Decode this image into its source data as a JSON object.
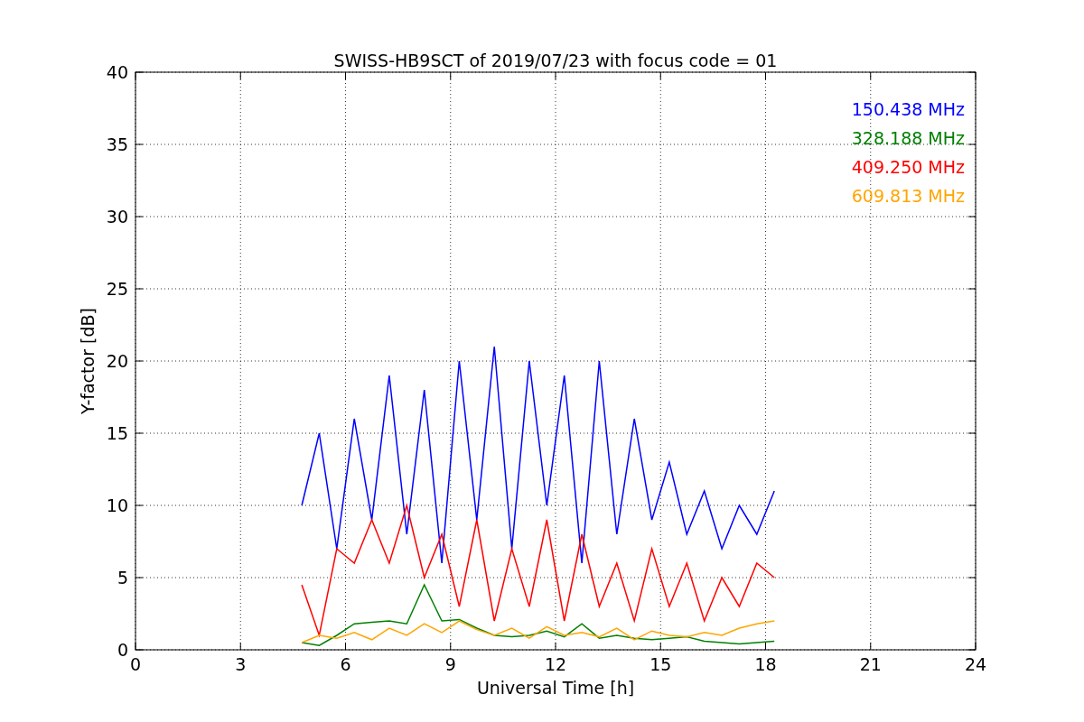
{
  "figure": {
    "chart_data": {
      "type": "line",
      "title": "SWISS-HB9SCT of 2019/07/23 with focus code = 01",
      "xlabel": "Universal Time [h]",
      "ylabel": "Y-factor [dB]",
      "x": [
        4.75,
        5.25,
        5.75,
        6.25,
        6.75,
        7.25,
        7.75,
        8.25,
        8.75,
        9.25,
        9.75,
        10.25,
        10.75,
        11.25,
        11.75,
        12.25,
        12.75,
        13.25,
        13.75,
        14.25,
        14.75,
        15.25,
        15.75,
        16.25,
        16.75,
        17.25,
        17.75,
        18.25
      ],
      "series": [
        {
          "name": "150.438 MHz",
          "color": "#0000ff",
          "values": [
            10,
            15,
            7,
            16,
            9,
            19,
            8,
            18,
            6,
            20,
            9,
            21,
            7,
            20,
            10,
            19,
            6,
            20,
            8,
            16,
            9,
            13,
            8,
            11,
            7,
            10,
            8,
            11
          ]
        },
        {
          "name": "328.188 MHz",
          "color": "#008000",
          "values": [
            0.5,
            0.3,
            1,
            1.8,
            1.9,
            2,
            1.8,
            4.5,
            2,
            2.1,
            1.5,
            1,
            0.9,
            1,
            1.3,
            0.9,
            1.8,
            0.8,
            1,
            0.8,
            0.7,
            0.8,
            0.9,
            0.6,
            0.5,
            0.4,
            0.5,
            0.6
          ]
        },
        {
          "name": "409.250 MHz",
          "color": "#ff0000",
          "values": [
            4.5,
            1,
            7,
            6,
            9,
            6,
            10,
            5,
            8,
            3,
            9,
            2,
            7,
            3,
            9,
            2,
            8,
            3,
            6,
            2,
            7,
            3,
            6,
            2,
            5,
            3,
            6,
            5
          ]
        },
        {
          "name": "609.813 MHz",
          "color": "#ffa500",
          "values": [
            0.5,
            1,
            0.8,
            1.2,
            0.7,
            1.5,
            1,
            1.8,
            1.2,
            2,
            1.4,
            1,
            1.5,
            0.8,
            1.6,
            1,
            1.2,
            0.9,
            1.5,
            0.7,
            1.3,
            1,
            0.9,
            1.2,
            1,
            1.5,
            1.8,
            2
          ]
        }
      ],
      "grid": true,
      "xlim": [
        0,
        24
      ],
      "ylim": [
        0,
        40
      ],
      "xticks": [
        0,
        3,
        6,
        9,
        12,
        15,
        18,
        21,
        24
      ],
      "yticks": [
        0,
        5,
        10,
        15,
        20,
        25,
        30,
        35,
        40
      ]
    }
  }
}
